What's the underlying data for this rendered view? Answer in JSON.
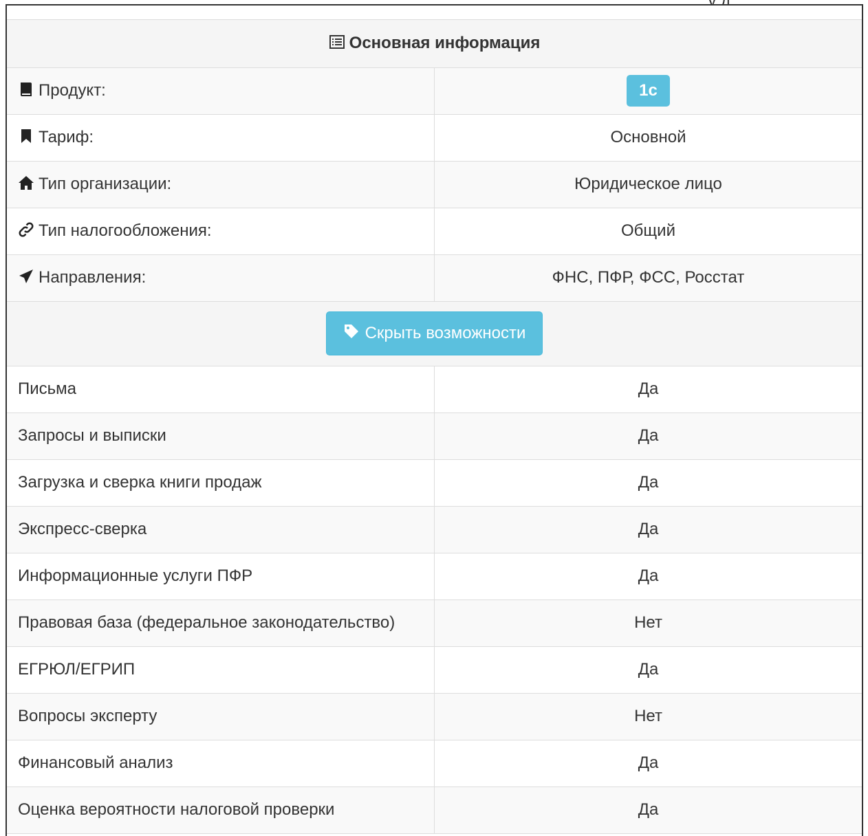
{
  "header": {
    "title": "Основная информация",
    "partial_top_text": "у  д"
  },
  "info_rows": [
    {
      "icon": "book-icon",
      "label": "Продукт:",
      "value": "1с",
      "type": "badge"
    },
    {
      "icon": "bookmark-icon",
      "label": "Тариф:",
      "value": "Основной"
    },
    {
      "icon": "home-icon",
      "label": "Тип организации:",
      "value": "Юридическое лицо"
    },
    {
      "icon": "link-icon",
      "label": "Тип налогообложения:",
      "value": "Общий"
    },
    {
      "icon": "send-icon",
      "label": "Направления:",
      "value": "ФНС, ПФР, ФСС, Росстат"
    }
  ],
  "toggle_button": {
    "icon": "tag-icon",
    "label": "Скрыть возможности"
  },
  "features": [
    {
      "label": "Письма",
      "value": "Да"
    },
    {
      "label": "Запросы и выписки",
      "value": "Да"
    },
    {
      "label": "Загрузка и сверка книги продаж",
      "value": "Да"
    },
    {
      "label": "Экспресс-сверка",
      "value": "Да"
    },
    {
      "label": "Информационные услуги ПФР",
      "value": "Да"
    },
    {
      "label": "Правовая база (федеральное законодательство)",
      "value": "Нет"
    },
    {
      "label": "ЕГРЮЛ/ЕГРИП",
      "value": "Да"
    },
    {
      "label": "Вопросы эксперту",
      "value": "Нет"
    },
    {
      "label": "Финансовый анализ",
      "value": "Да"
    },
    {
      "label": "Оценка вероятности налоговой проверки",
      "value": "Да"
    }
  ],
  "colors": {
    "accent": "#5bc0de",
    "stripe": "#f9f9f9",
    "header_bg": "#f5f5f5",
    "border": "#dddddd"
  }
}
